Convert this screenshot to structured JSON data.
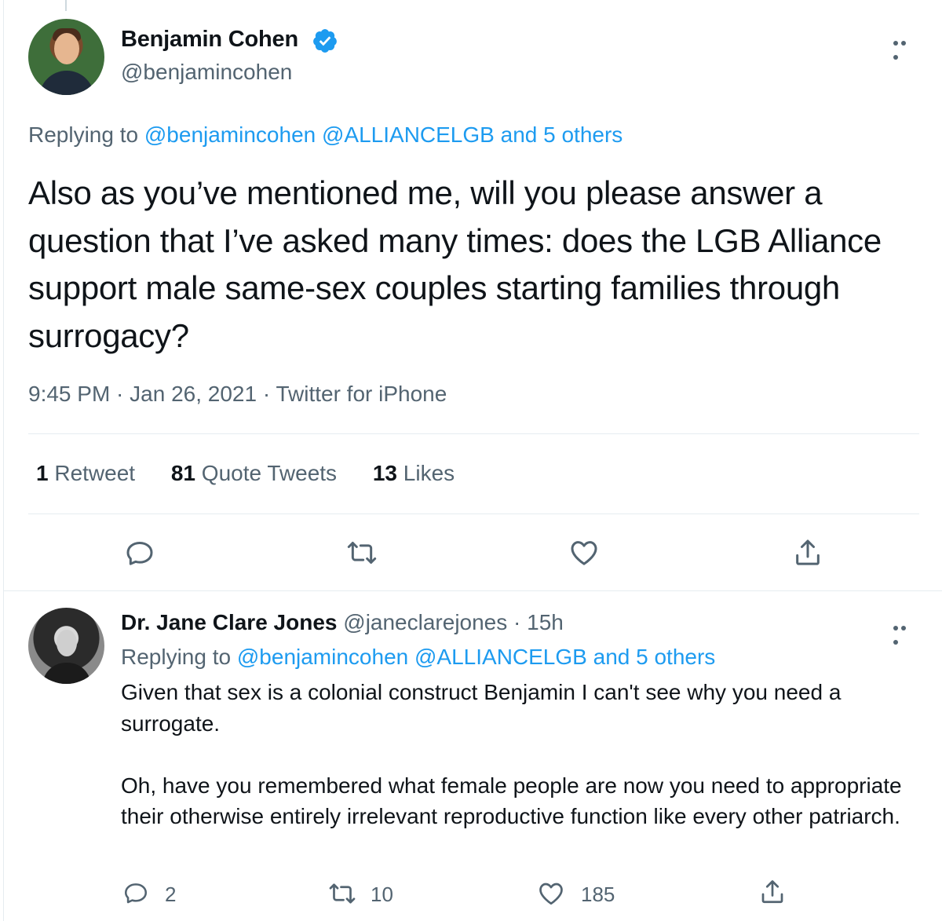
{
  "main_tweet": {
    "author_name": "Benjamin Cohen",
    "author_handle": "@benjamincohen",
    "replying_prefix": "Replying to ",
    "replying_mentions": "@benjamincohen @ALLIANCELGB and 5 others",
    "text": "Also as you’ve mentioned me, will you please answer a question that I’ve asked many times: does the LGB Alliance support male same-sex couples starting families through surrogacy?",
    "meta": "9:45 PM · Jan 26, 2021 · Twitter for iPhone",
    "stats": {
      "retweets_count": "1",
      "retweets_label": "Retweet",
      "quotes_count": "81",
      "quotes_label": "Quote Tweets",
      "likes_count": "13",
      "likes_label": "Likes"
    },
    "verified_color": "#1d9bf0"
  },
  "reply_tweet": {
    "author_name": "Dr. Jane Clare Jones",
    "author_handle_time": "@janeclarejones · 15h",
    "replying_prefix": "Replying to ",
    "replying_mentions": "@benjamincohen @ALLIANCELGB and 5 others",
    "text": "Given that sex is a colonial construct Benjamin I can't see why you need a surrogate.\n\nOh, have you remembered what female people are now you need to appropriate their otherwise entirely irrelevant reproductive function like every other patriarch.",
    "counts": {
      "replies": "2",
      "retweets": "10",
      "likes": "185"
    }
  },
  "icons": {
    "reply": "reply-icon",
    "retweet": "retweet-icon",
    "like": "like-icon",
    "share": "share-icon",
    "more": "more-icon",
    "verified": "verified-badge-icon"
  },
  "colors": {
    "link": "#1d9bf0",
    "secondary_text": "#536471",
    "primary_text": "#0f1419",
    "divider": "#e6ecf0"
  }
}
